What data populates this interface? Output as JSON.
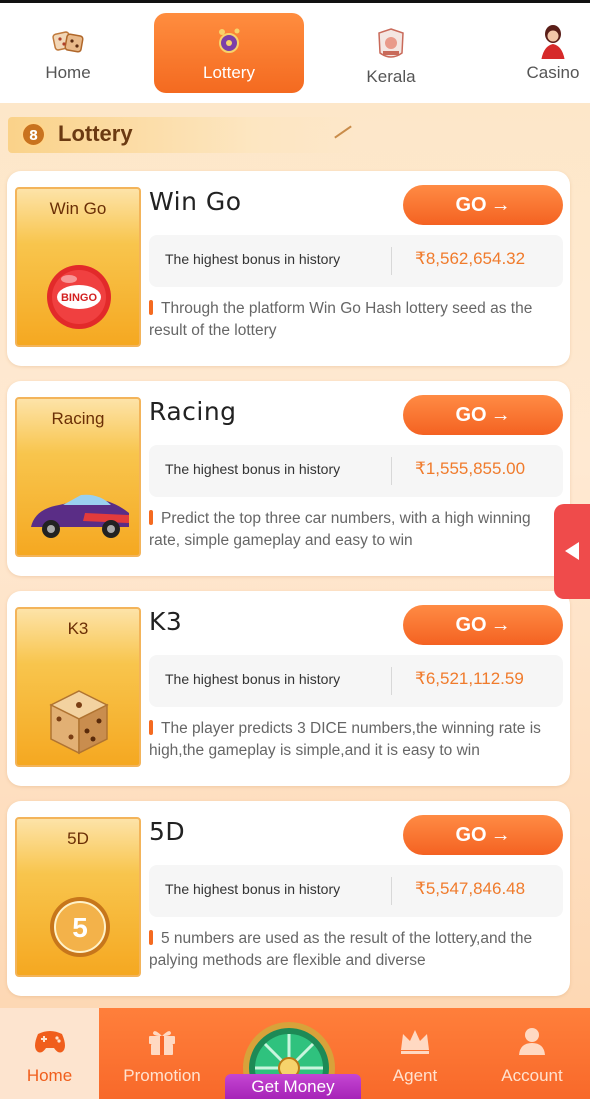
{
  "top_tabs": [
    {
      "label": "Home",
      "icon": "home-dice-icon"
    },
    {
      "label": "Lottery",
      "icon": "lottery-ball-icon",
      "active": true
    },
    {
      "label": "Kerala",
      "icon": "kerala-badge-icon"
    },
    {
      "label": "Casino",
      "icon": "casino-dealer-icon"
    }
  ],
  "section": {
    "badge": "8",
    "title": "Lottery"
  },
  "games": [
    {
      "thumb_label": "Win Go",
      "name": "Win Go",
      "go_label": "GO",
      "stats_label": "The highest bonus in history",
      "amount": "₹8,562,654.32",
      "description": "Through the platform Win Go Hash lottery seed as the result of the lottery"
    },
    {
      "thumb_label": "Racing",
      "name": "Racing",
      "go_label": "GO",
      "stats_label": "The highest bonus in history",
      "amount": "₹1,555,855.00",
      "description": "Predict the top three car numbers, with a high winning rate, simple gameplay and easy to win"
    },
    {
      "thumb_label": "K3",
      "name": "K3",
      "go_label": "GO",
      "stats_label": "The highest bonus in history",
      "amount": "₹6,521,112.59",
      "description": "The player predicts 3 DICE numbers,the winning rate is high,the gameplay is simple,and it is easy to win"
    },
    {
      "thumb_label": "5D",
      "name": "5D",
      "go_label": "GO",
      "stats_label": "The highest bonus in history",
      "amount": "₹5,547,846.48",
      "description": "5 numbers are used as the result of the lottery,and the palying methods are flexible and diverse"
    }
  ],
  "bingo_text": "BINGO",
  "five_d_coin": "5",
  "bottom_nav": [
    {
      "label": "Home",
      "icon": "gamepad-icon",
      "active": true
    },
    {
      "label": "Promotion",
      "icon": "gift-icon"
    },
    {
      "label": "Get Money",
      "icon": "wheel-icon"
    },
    {
      "label": "Agent",
      "icon": "crown-icon"
    },
    {
      "label": "Account",
      "icon": "user-icon"
    }
  ],
  "colors": {
    "accent": "#f46a20",
    "amount": "#f07b2c",
    "side_handle": "#ef4b4b",
    "get_money": "#b52fc5"
  }
}
